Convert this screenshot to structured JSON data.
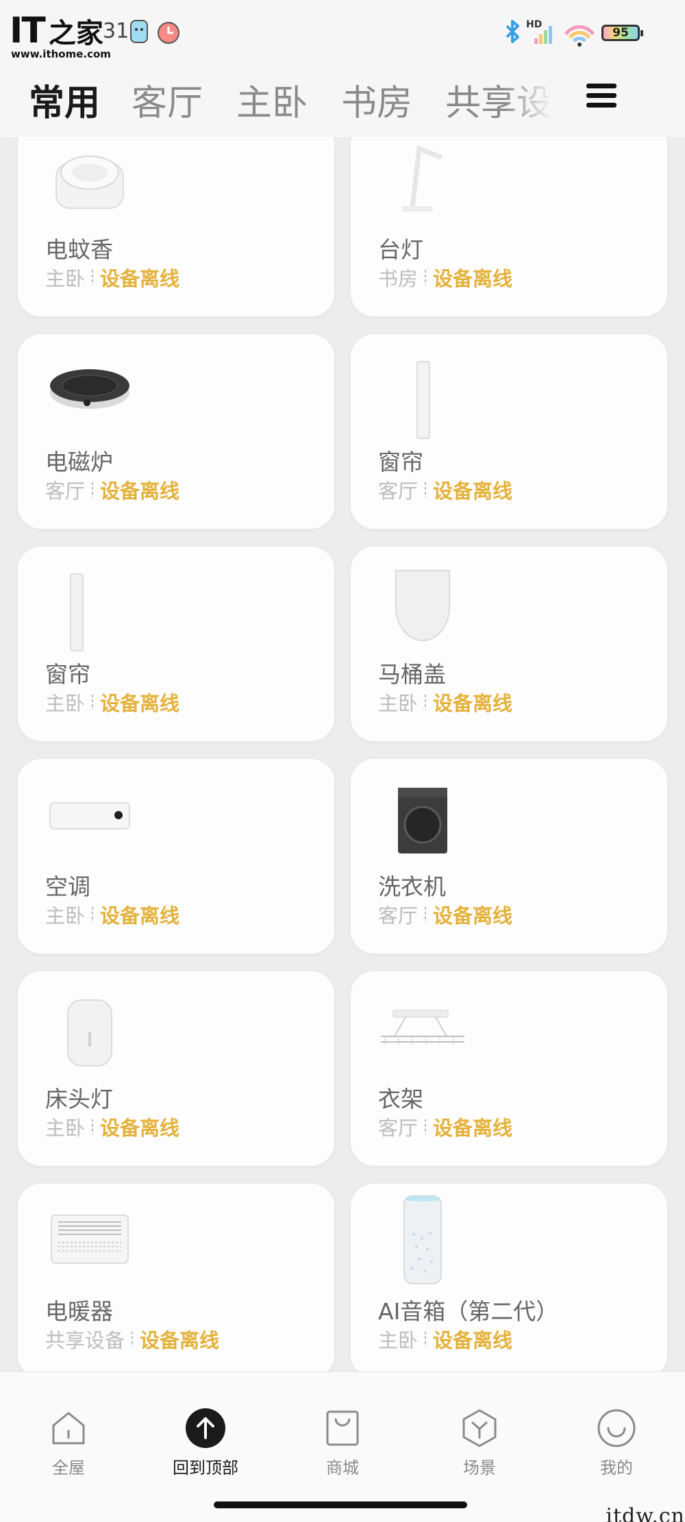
{
  "statusbar": {
    "logo_it": "IT",
    "logo_cn": "之家",
    "logo_url": "www.ithome.com",
    "clock": "31",
    "battery": "95",
    "icons": [
      "bluetooth-icon",
      "hd-signal-icon",
      "wifi-icon",
      "battery-icon"
    ]
  },
  "tabs": [
    {
      "label": "常用",
      "active": true
    },
    {
      "label": "客厅",
      "active": false
    },
    {
      "label": "主卧",
      "active": false
    },
    {
      "label": "书房",
      "active": false
    },
    {
      "label": "共享设",
      "active": false
    }
  ],
  "devices": [
    {
      "name": "电蚊香",
      "room": "主卧",
      "status": "设备离线",
      "icon": "mosquito-repeller-icon"
    },
    {
      "name": "台灯",
      "room": "书房",
      "status": "设备离线",
      "icon": "desk-lamp-icon"
    },
    {
      "name": "电磁炉",
      "room": "客厅",
      "status": "设备离线",
      "icon": "induction-cooker-icon"
    },
    {
      "name": "窗帘",
      "room": "客厅",
      "status": "设备离线",
      "icon": "curtain-icon"
    },
    {
      "name": "窗帘",
      "room": "主卧",
      "status": "设备离线",
      "icon": "curtain-icon"
    },
    {
      "name": "马桶盖",
      "room": "主卧",
      "status": "设备离线",
      "icon": "toilet-seat-icon"
    },
    {
      "name": "空调",
      "room": "主卧",
      "status": "设备离线",
      "icon": "air-conditioner-icon"
    },
    {
      "name": "洗衣机",
      "room": "客厅",
      "status": "设备离线",
      "icon": "washing-machine-icon"
    },
    {
      "name": "床头灯",
      "room": "主卧",
      "status": "设备离线",
      "icon": "bedside-lamp-icon"
    },
    {
      "name": "衣架",
      "room": "客厅",
      "status": "设备离线",
      "icon": "clothes-rack-icon"
    },
    {
      "name": "电暖器",
      "room": "共享设备",
      "status": "设备离线",
      "icon": "heater-icon"
    },
    {
      "name": "AI音箱（第二代）",
      "room": "主卧",
      "status": "设备离线",
      "icon": "smart-speaker-icon"
    }
  ],
  "bottom_nav": [
    {
      "label": "全屋",
      "icon": "home-icon"
    },
    {
      "label": "回到顶部",
      "icon": "back-to-top-icon"
    },
    {
      "label": "商城",
      "icon": "shop-bag-icon"
    },
    {
      "label": "场景",
      "icon": "scene-hexagon-icon"
    },
    {
      "label": "我的",
      "icon": "profile-smile-icon"
    }
  ],
  "watermark": "itdw.cn"
}
